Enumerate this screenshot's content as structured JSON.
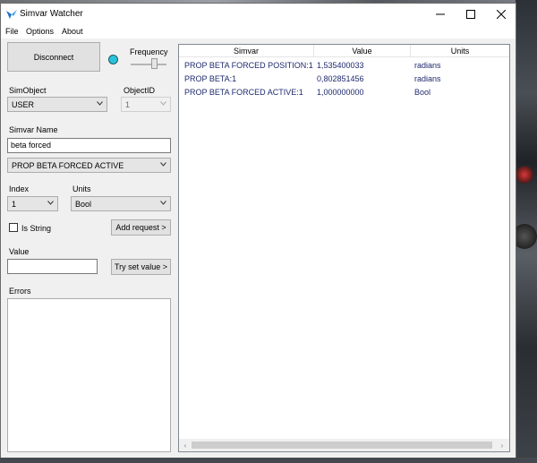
{
  "window": {
    "title": "Simvar Watcher"
  },
  "menu": [
    "File",
    "Options",
    "About"
  ],
  "controls": {
    "disconnect_label": "Disconnect",
    "frequency_label": "Frequency",
    "indicator_color": "#29c3d8",
    "simobject_label": "SimObject",
    "simobject_value": "USER",
    "objectid_label": "ObjectID",
    "objectid_value": "1",
    "simvar_name_label": "Simvar Name",
    "simvar_name_value": "beta forced",
    "simvar_select_value": "PROP BETA FORCED ACTIVE",
    "index_label": "Index",
    "index_value": "1",
    "units_label": "Units",
    "units_value": "Bool",
    "is_string_label": "Is String",
    "is_string_checked": false,
    "add_request_label": "Add request >",
    "value_label": "Value",
    "value_input": "",
    "try_set_label": "Try set value >",
    "errors_label": "Errors"
  },
  "grid": {
    "columns": [
      "Simvar",
      "Value",
      "Units"
    ],
    "rows": [
      {
        "simvar": "PROP BETA FORCED POSITION:1",
        "value": "1,535400033",
        "units": "radians"
      },
      {
        "simvar": "PROP BETA:1",
        "value": "0,802851456",
        "units": "radians"
      },
      {
        "simvar": "PROP BETA FORCED ACTIVE:1",
        "value": "1,000000000",
        "units": "Bool"
      }
    ]
  }
}
